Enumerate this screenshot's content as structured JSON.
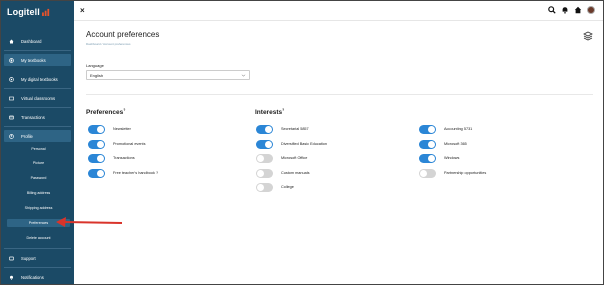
{
  "brand": {
    "name": "Logitell",
    "accent": "#e8532b"
  },
  "sidebar": {
    "items": [
      {
        "label": "Dashboard",
        "icon": "home-icon"
      },
      {
        "label": "My textbooks",
        "icon": "book-icon"
      },
      {
        "label": "My digital textbooks",
        "icon": "tablet-icon"
      },
      {
        "label": "Virtual classrooms",
        "icon": "classroom-icon"
      },
      {
        "label": "Transactions",
        "icon": "receipt-icon"
      },
      {
        "label": "Profile",
        "icon": "user-icon"
      }
    ],
    "profile_sub": [
      "Personal",
      "Picture",
      "Password",
      "Billing address",
      "Shipping address",
      "Preferences",
      "Delete account"
    ],
    "bottom_items": [
      {
        "label": "Support",
        "icon": "support-icon"
      },
      {
        "label": "Notifications",
        "icon": "bell-icon"
      }
    ]
  },
  "topbar": {
    "close": "×"
  },
  "main": {
    "title": "Account preferences",
    "breadcrumb": "Dashboard  /  Account preferences",
    "language": {
      "label": "Language",
      "value": "English"
    },
    "preferences": {
      "title": "Preferences",
      "mark": "?",
      "items": [
        {
          "label": "Newsletter",
          "on": true
        },
        {
          "label": "Promotional events",
          "on": true
        },
        {
          "label": "Transactions",
          "on": true
        },
        {
          "label": "Free teacher's handbook ?",
          "on": true
        }
      ]
    },
    "interests": {
      "title": "Interests",
      "mark": "?",
      "col1": [
        {
          "label": "Secretarial 5857",
          "on": true
        },
        {
          "label": "Diversified Basic Education",
          "on": true
        },
        {
          "label": "Microsoft Office",
          "on": false
        },
        {
          "label": "Custom manuals",
          "on": false
        },
        {
          "label": "College",
          "on": false
        }
      ],
      "col2": [
        {
          "label": "Accounting 5731",
          "on": true
        },
        {
          "label": "Microsoft 365",
          "on": true
        },
        {
          "label": "Windows",
          "on": true
        },
        {
          "label": "Partnership opportunities",
          "on": false
        }
      ]
    }
  },
  "colors": {
    "sidebar": "#1b4a66",
    "toggle_on": "#2b86d6",
    "toggle_off": "#d4d4d4",
    "arrow": "#d9342b"
  }
}
